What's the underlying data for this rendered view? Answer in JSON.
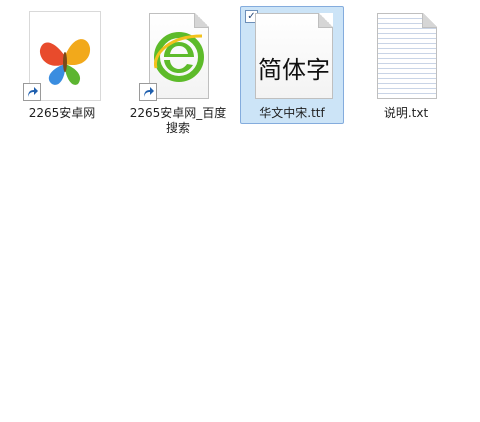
{
  "files": [
    {
      "name": "2265安卓网",
      "icon": "butterfly-logo-icon",
      "shortcut": true,
      "selected": false
    },
    {
      "name": "2265安卓网_百度搜索",
      "icon": "browser-e-icon",
      "shortcut": true,
      "selected": false
    },
    {
      "name": "华文中宋.ttf",
      "icon": "font-file-icon",
      "preview_text": "简体字",
      "selected": true,
      "checkbox_mark": "✓"
    },
    {
      "name": "说明.txt",
      "icon": "text-file-icon",
      "shortcut": false,
      "selected": false
    }
  ],
  "colors": {
    "selection_bg": "#cce4f7",
    "selection_border": "#84acdd",
    "shortcut_arrow": "#1f5fae",
    "browser_green": "#5dbb2a"
  }
}
